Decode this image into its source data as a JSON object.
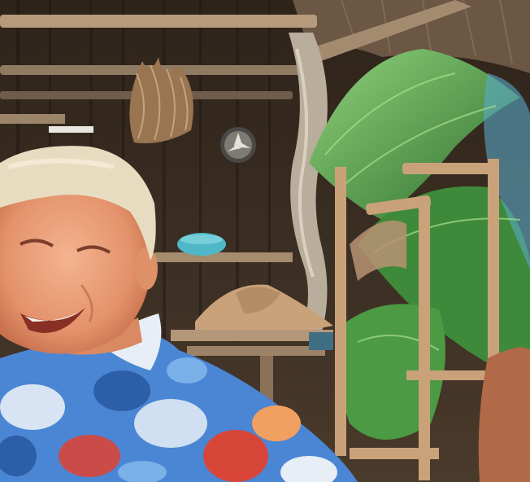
{
  "scene": {
    "subject_elements": [
      "thatched-roof",
      "wooden-shelves",
      "palm-fronds",
      "wooden-chair",
      "person",
      "floral-shirt",
      "turquoise-bowl",
      "straw-hat",
      "dried-palm-ornament",
      "fan"
    ],
    "colors": {
      "wall_dark": "#3a2c20",
      "wood_light": "#c9a27a",
      "palm_green": "#3f8a3a",
      "palm_light": "#7cc46a",
      "bowl": "#4fb8c8",
      "skin": "#e9a07a",
      "hair": "#e8dcc0",
      "shirt_blue": "#4a86d4",
      "shirt_red": "#d8463a",
      "shirt_white": "#e8eef6"
    }
  }
}
